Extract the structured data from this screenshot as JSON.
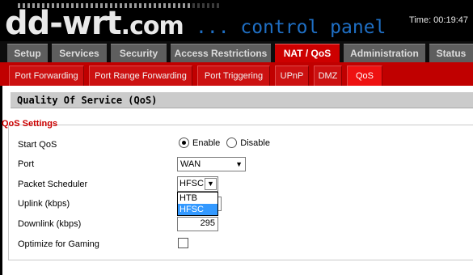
{
  "header": {
    "logo_main": "dd-wrt",
    "logo_suffix": ".com",
    "tagline": "... control panel",
    "time_label": "Time: 00:19:47"
  },
  "main_tabs": [
    {
      "label": "Setup"
    },
    {
      "label": "Services"
    },
    {
      "label": "Security"
    },
    {
      "label": "Access Restrictions"
    },
    {
      "label": "NAT / QoS"
    },
    {
      "label": "Administration"
    },
    {
      "label": "Status"
    }
  ],
  "sub_tabs": [
    {
      "label": "Port Forwarding"
    },
    {
      "label": "Port Range Forwarding"
    },
    {
      "label": "Port Triggering"
    },
    {
      "label": "UPnP"
    },
    {
      "label": "DMZ"
    },
    {
      "label": "QoS"
    }
  ],
  "section": {
    "title": "Quality Of Service (QoS)",
    "fieldset_title": "QoS Settings"
  },
  "fields": {
    "start_qos": {
      "label": "Start QoS",
      "enable": "Enable",
      "disable": "Disable",
      "selected": "Enable"
    },
    "port": {
      "label": "Port",
      "value": "WAN"
    },
    "scheduler": {
      "label": "Packet Scheduler",
      "value": "HFSC",
      "options": [
        "HTB",
        "HFSC"
      ]
    },
    "uplink": {
      "label": "Uplink (kbps)",
      "value": ""
    },
    "downlink": {
      "label": "Downlink (kbps)",
      "value": "295"
    },
    "gaming": {
      "label": "Optimize for Gaming",
      "checked": false
    }
  }
}
